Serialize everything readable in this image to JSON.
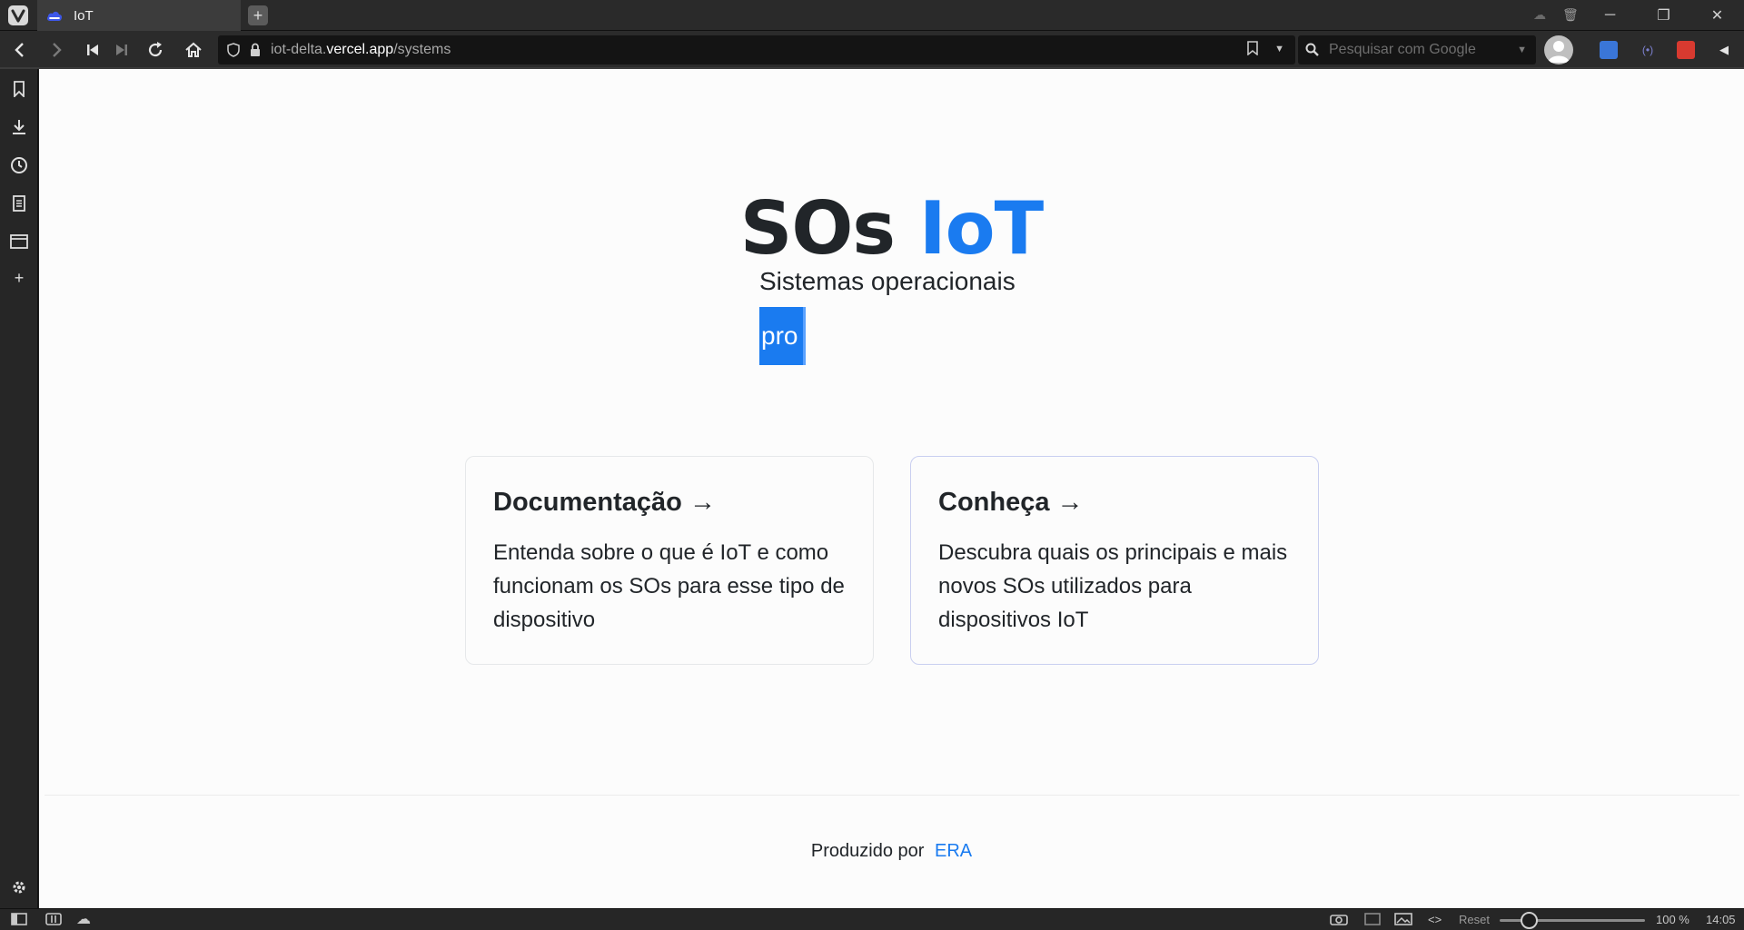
{
  "browser": {
    "tab_title": "IoT",
    "url": {
      "prefix": "iot-delta.",
      "host": "vercel.app",
      "path": "/systems"
    },
    "search_placeholder": "Pesquisar com Google"
  },
  "page": {
    "title_main": "SOs",
    "title_accent": "IoT",
    "subtitle": "Sistemas operacionais",
    "typing_text": "pro",
    "cards": [
      {
        "title": "Documentação →",
        "text": "Entenda sobre o que é IoT e como funcionam os SOs para esse tipo de dispositivo"
      },
      {
        "title": "Conheça →",
        "text": "Descubra quais os principais e mais novos SOs utilizados para dispositivos IoT"
      }
    ],
    "footer": {
      "text": "Produzido por",
      "link": "ERA"
    }
  },
  "statusbar": {
    "reset_label": "Reset",
    "zoom": "100 %",
    "time": "14:05"
  },
  "colors": {
    "accent": "#1a7bf0",
    "text": "#212529"
  }
}
